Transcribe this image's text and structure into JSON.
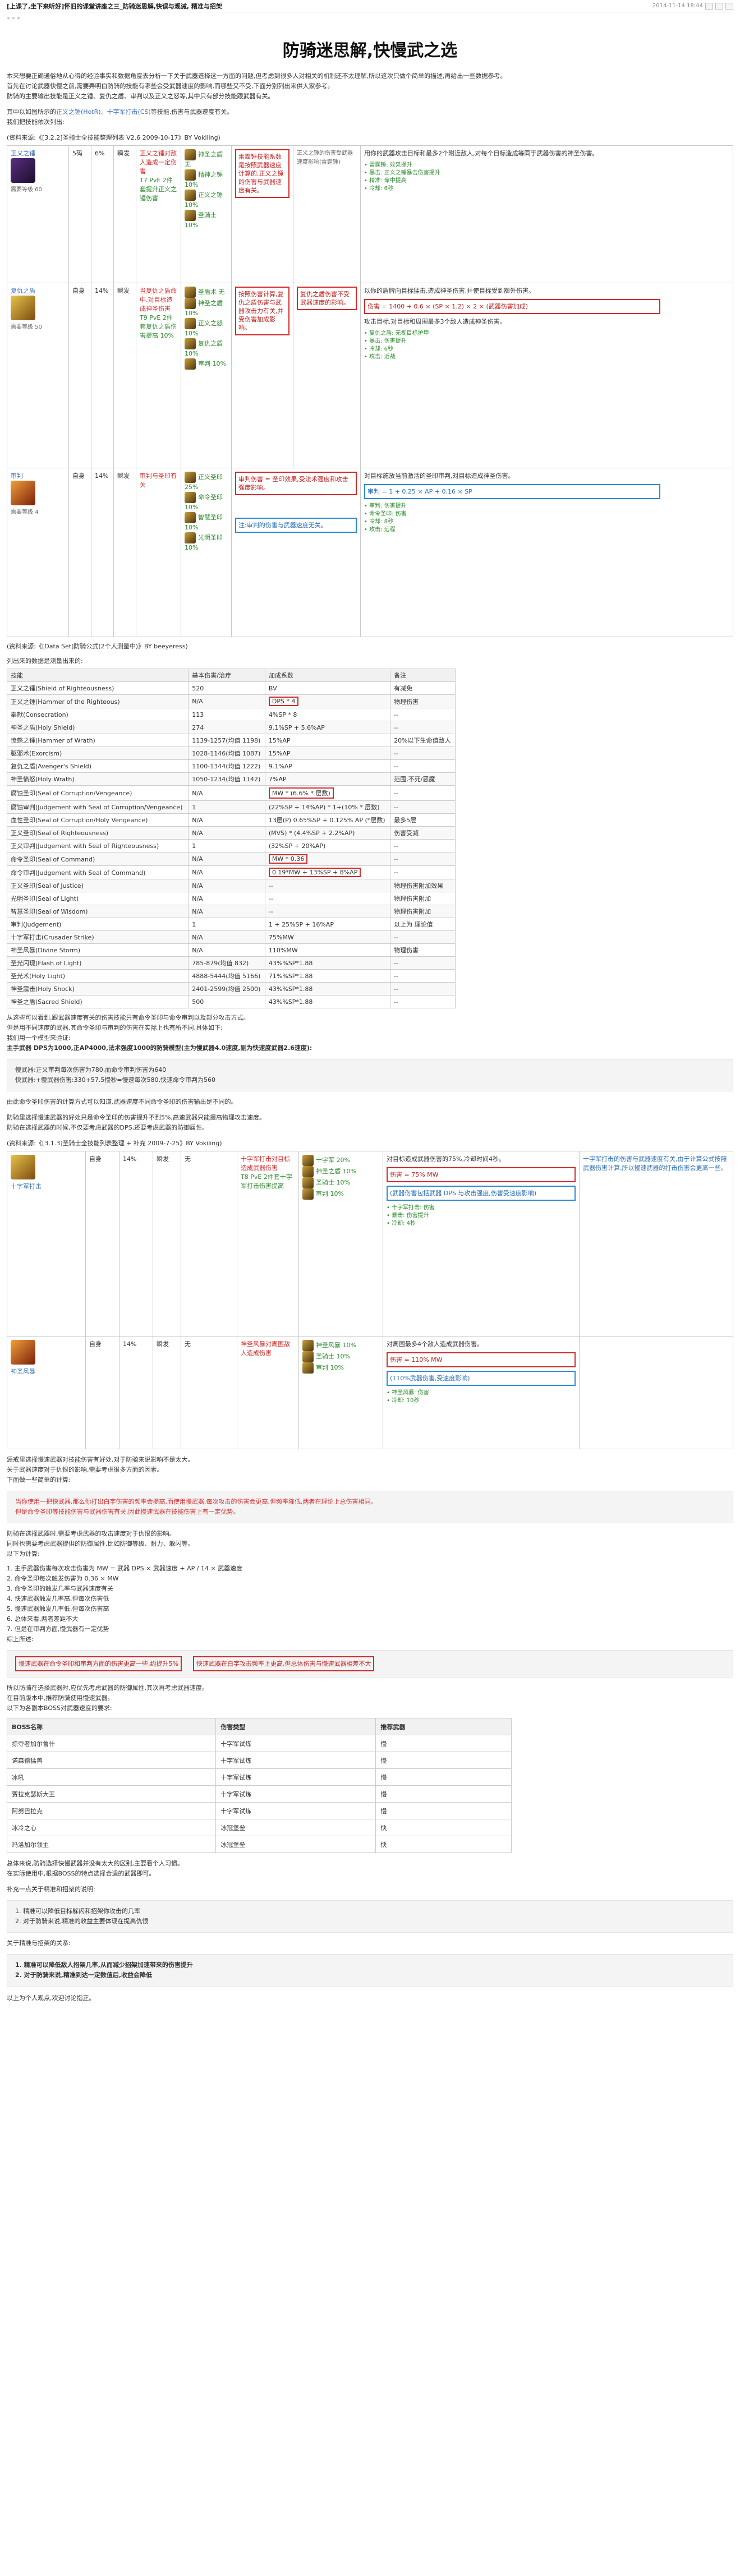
{
  "post": {
    "title": "[上课了,坐下来听好]怀旧的课堂讲座之三_防骑迷思解,快误与观诫, 精准与招架",
    "date": "2014-11-14 18:44",
    "stars": "* * *"
  },
  "article": {
    "heading": "防骑迷思解,快慢武之选"
  },
  "intro": {
    "l1": "本来想要正确通俗地从心得的经验事实和数据角度去分析一下关于武器选择这一方面的问题,但考虑到很多人对相关的机制还不太理解,所以这次只做个简单的描述,再给出一些数据参考。",
    "l2": "首先在讨论武器快慢之前,需要弄明白防骑的技能有哪些会受武器速度的影响,而哪些又不受,下面分别列出来供大家参考。",
    "l3": "防骑的主要输出技能是正义之锤、复仇之盾、审判以及正义之怒等,其中只有部分技能跟武器有关。",
    "l4a": "其中以如图所示的",
    "l4link": "正义之锤(HotR)、十字军打击(CS)",
    "l4b": "等技能,伤害与武器速度有关。",
    "l5": "我们把技能依次列出:"
  },
  "sources": {
    "s1": "(资料来源:《[3.2.2]圣骑士全技能整理列表 V2.6 2009-10-17》BY Vokiling)",
    "s2": "(资料来源:《[Data Set]防骑公式(2个人测量中)》BY beeyeress)",
    "s3": "列出来的数据是测量出来的:",
    "s4": "(资料来源:《[3.1.3]圣骑士全技能列表整理 + 补充 2009-7-25》BY Vokiling)"
  },
  "block1": {
    "row1": {
      "name": "正义之锤",
      "caption": "需要等级 60",
      "c1": "5码",
      "c2": "6%",
      "c3": "瞬发",
      "c4a": "正义之锤对敌人造成一定伤害",
      "c4b": "T7 PvE 2件套提升正义之锤伤害",
      "t1": "神圣之盾 无",
      "t2": "精神之锤 10%",
      "t3": "正义之锤 10%",
      "t4": "圣骑士 10%",
      "note": "雷霆锤技能系数是按照武器速度计算的,正义之锤的伤害与武器速度有关。",
      "note2": "正义之锤的伤害受武器速度影响(雷霆锤)",
      "desc": "用你的武器攻击目标和最多2个附近敌人,对每个目标造成等同于武器伤害的神圣伤害。",
      "b1": "• 雷霆锤: 效果提升",
      "b2": "• 暴击: 正义之锤暴击伤害提升",
      "b3": "• 精准: 命中提高",
      "b4": "• 冷却: 6秒"
    },
    "row2": {
      "name": "复仇之盾",
      "caption": "需要等级 50",
      "c1": "自身",
      "c2": "14%",
      "c3": "瞬发",
      "c4a": "当复仇之盾命中,对目标造成神圣伤害",
      "c4b": "T9 PvE 2件套复仇之盾伤害提高 10%",
      "t1": "圣盾术 无",
      "t2": "神圣之盾 10%",
      "t3": "正义之怒 10%",
      "t4": "复仇之盾 10%",
      "t5": "审判 10%",
      "note": "按照伤害计算,复仇之盾伤害与武器攻击力有关,并受伤害加成影响。",
      "note2": "复仇之盾伤害不受武器速度的影响。",
      "desc": "以你的盾牌向目标猛击,造成神圣伤害,并使目标受到额外伤害。",
      "formula": "伤害 = 1400 + 0.6 × (SP × 1.2) × 2 × (武器伤害加成)",
      "desc2": "攻击目标,对目标和周围最多3个敌人造成神圣伤害。",
      "b1": "• 复仇之盾: 无视目标护甲",
      "b2": "• 暴击: 伤害提升",
      "b3": "• 冷却: 6秒",
      "b4": "• 攻击: 近战"
    },
    "row3": {
      "name": "审判",
      "caption": "需要等级 4",
      "c1": "自身",
      "c2": "14%",
      "c3": "瞬发",
      "c4a": "审判与圣印有关",
      "t1": "正义圣印 25%",
      "t2": "命令圣印 10%",
      "t3": "智慧圣印 10%",
      "t4": "光明圣印 10%",
      "note": "审判伤害 = 圣印效果,受法术强度和攻击强度影响。",
      "note2": "注:审判的伤害与武器速度无关。",
      "desc": "对目标施放当前激活的圣印审判,对目标造成神圣伤害。",
      "formula": "审判 = 1 + 0.25 × AP + 0.16 × SP",
      "b1": "• 审判: 伤害提升",
      "b2": "• 命令圣印: 伤害",
      "b3": "• 冷却: 8秒",
      "b4": "• 攻击: 远程"
    }
  },
  "table1": {
    "headers": [
      "技能",
      "基本伤害/治疗",
      "加成系数",
      "备注"
    ],
    "rows": [
      [
        "正义之锤(Shield of Righteousness)",
        "520",
        "BV",
        "有减免"
      ],
      [
        "正义之锤(Hammer of the Righteous)",
        "N/A",
        "DPS * 4",
        "物理伤害"
      ],
      [
        "奉献(Consecration)",
        "113",
        "4%SP * 8",
        "--"
      ],
      [
        "神圣之盾(Holy Shield)",
        "274",
        "9.1%SP + 5.6%AP",
        "--"
      ],
      [
        "愤怒之锤(Hammer of Wrath)",
        "1139-1257(均值 1198)",
        "15%AP",
        "20%以下生命值敌人"
      ],
      [
        "驱邪术(Exorcism)",
        "1028-1146(均值 1087)",
        "15%AP",
        "--"
      ],
      [
        "复仇之盾(Avenger's Shield)",
        "1100-1344(均值 1222)",
        "9.1%AP",
        "--"
      ],
      [
        "神圣愤怒(Holy Wrath)",
        "1050-1234(均值 1142)",
        "7%AP",
        "范围,不死/恶魔"
      ],
      [
        "腐蚀圣印(Seal of Corruption/Vengeance)",
        "N/A",
        "MW * (6.6% * 层数)",
        "--"
      ],
      [
        "腐蚀审判(Judgement with Seal of Corruption/Vengeance)",
        "1",
        "(22%SP + 14%AP) * 1+(10% * 层数)",
        "--"
      ],
      [
        "血性圣印(Seal of Corruption/Holy Vengeance)",
        "N/A",
        "13层(P) 0.65%SP + 0.125% AP (*层数)",
        "最多5层"
      ],
      [
        "正义圣印(Seal of Righteousness)",
        "N/A",
        "(MVS) * (4.4%SP + 2.2%AP)",
        "伤害受减"
      ],
      [
        "正义审判(Judgement with Seal of Righteousness)",
        "1",
        "(32%SP + 20%AP)",
        "--"
      ],
      [
        "命令圣印(Seal of Command)",
        "N/A",
        "MW * 0.36",
        "--"
      ],
      [
        "命令审判(Judgement with Seal of Command)",
        "N/A",
        "0.19*MW + 13%SP + 8%AP",
        "--"
      ],
      [
        "正义圣印(Seal of Justice)",
        "N/A",
        "--",
        "物理伤害附加效果"
      ],
      [
        "光明圣印(Seal of Light)",
        "N/A",
        "--",
        "物理伤害附加"
      ],
      [
        "智慧圣印(Seal of Wisdom)",
        "N/A",
        "--",
        "物理伤害附加"
      ],
      [
        "审判(Judgement)",
        "1",
        "1 + 25%SP + 16%AP",
        "以上为 理论值"
      ],
      [
        "十字军打击(Crusader Strike)",
        "N/A",
        "75%MW",
        "--"
      ],
      [
        "神圣风暴(Divine Storm)",
        "N/A",
        "110%MW",
        "物理伤害"
      ],
      [
        "圣光闪现(Flash of Light)",
        "785-879(均值 832)",
        "43%%SP*1.88",
        "--"
      ],
      [
        "圣光术(Holy Light)",
        "4888-5444(均值 5166)",
        "71%%SP*1.88",
        "--"
      ],
      [
        "神圣震击(Holy Shock)",
        "2401-2599(均值 2500)",
        "43%%SP*1.88",
        "--"
      ],
      [
        "神圣之盾(Sacred Shield)",
        "500",
        "43%%SP*1.88",
        "--"
      ]
    ]
  },
  "after_table": {
    "l1": "从这些可以看到,跟武器速度有关的伤害技能只有命令圣印与命令审判以及部分攻击方式。",
    "l2": "但是用不同速度的武器,其命令圣印与审判的伤害在实际上也有所不同,具体如下:",
    "l3": "我们用一个模型来验证:",
    "l4": "主手武器 DPS为1000,正AP4000,法术强度1000的防骑模型(主为慢武器4.0速度,副为快速度武器2.6速度):"
  },
  "quote1": {
    "l1": "慢武器:正义审判每次伤害为780,而命令审判伤害为640",
    "l2": "快武器:+慢武器伤害:330+57.5慢秒=慢速每次580,快速命令审判为560"
  },
  "after_quote": {
    "l1": "由此命令圣印伤害的计算方式可以知道,武器速度不同命令圣印的伤害输出是不同的。",
    "l2": "防骑里选择慢速武器的好处只是命令圣印的伤害提升不到5%,高速武器只能提高物理攻击速度。",
    "l3": "防骑在选择武器的时候,不仅要考虑武器的DPS,还要考虑武器的防御属性。"
  },
  "block2": {
    "row1": {
      "name": "十字军打击",
      "c1": "自身",
      "c2": "14%",
      "c3": "瞬发",
      "c4": "无",
      "c5a": "十字军打击对目标造成武器伤害",
      "c5b": "T8 PvE 2件套十字军打击伤害提高",
      "t1": "十字军 20%",
      "t2": "神圣之盾 10%",
      "t3": "圣骑士 10%",
      "t4": "审判 10%",
      "desc": "对目标造成武器伤害的75%,冷却时间4秒。",
      "formula": "伤害 = 75% MW",
      "formula2": "(武器伤害包括武器 DPS 与攻击强度,伤害受速度影响)",
      "b1": "• 十字军打击: 伤害",
      "b2": "• 暴击: 伤害提升",
      "b3": "• 冷却: 4秒",
      "side": "十字军打击的伤害与武器速度有关,由于计算公式按照武器伤害计算,所以慢速武器的打击伤害会更高一些。"
    },
    "row2": {
      "name": "神圣风暴",
      "c1": "自身",
      "c2": "14%",
      "c3": "瞬发",
      "c4": "无",
      "c5a": "神圣风暴对周围敌人造成伤害",
      "t1": "神圣风暴 10%",
      "t2": "圣骑士 10%",
      "t3": "审判 10%",
      "desc": "对周围最多4个敌人造成武器伤害。",
      "formula": "伤害 = 110% MW",
      "formula2": "(110%武器伤害,受速度影响)",
      "b1": "• 神圣风暴: 伤害",
      "b2": "• 冷却: 10秒"
    }
  },
  "after_block2": {
    "l1": "惩戒里选择慢速武器对技能伤害有好处,对于防骑来说影响不是太大。",
    "l2": "关于武器速度对于仇恨的影响,需要考虑很多方面的因素。",
    "l3": "下面做一些简单的计算:"
  },
  "quote2": {
    "l1": "当你使用一把快武器,那么你打出白字伤害的频率会提高,而使用慢武器,每次攻击的伤害会更高,但频率降低,两者在理论上总伤害相同。",
    "l2": "但是命令圣印等技能伤害与武器伤害有关,因此慢速武器在技能伤害上有一定优势。"
  },
  "calc": {
    "l1": "防骑在选择武器时,需要考虑武器的攻击速度对于仇恨的影响。",
    "l2": "同时也需要考虑武器提供的防御属性,比如防御等级、耐力、躲闪等。",
    "l3": "以下为计算:",
    "l4": "1. 主手武器伤害每次攻击伤害为 MW = 武器 DPS × 武器速度 + AP / 14 × 武器速度",
    "l5": "2. 命令圣印每次触发伤害为 0.36 × MW",
    "l6": "3. 命令圣印的触发几率与武器速度有关",
    "l7": "4. 快速武器触发几率高,但每次伤害低",
    "l8": "5. 慢速武器触发几率低,但每次伤害高",
    "l9": "6. 总体来看,两者差距不大",
    "l10": "7. 但是在审判方面,慢武器有一定优势",
    "l11": "综上所述:"
  },
  "quote3": {
    "l1": "慢速武器在命令圣印和审判方面的伤害更高一些,约提升5%",
    "l2": "快速武器在白字攻击频率上更高,但总体伤害与慢速武器相差不大"
  },
  "after_quote3": {
    "l1": "所以防骑在选择武器时,应优先考虑武器的防御属性,其次再考虑武器速度。",
    "l2": "在目前版本中,推荐防骑使用慢速武器。",
    "l3": "以下为各副本BOSS对武器速度的要求:"
  },
  "table2": {
    "headers": [
      "BOSS名称",
      "伤害类型",
      "推荐武器"
    ],
    "rows": [
      [
        "掠夺者加尔鲁什",
        "十字军试炼",
        "慢"
      ],
      [
        "诺森德猛兽",
        "十字军试炼",
        "慢"
      ],
      [
        "冰吼",
        "十字军试炼",
        "慢"
      ],
      [
        "贾拉克瑟斯大王",
        "十字军试炼",
        "慢"
      ],
      [
        "阿努巴拉克",
        "十字军试炼",
        "慢"
      ],
      [
        "冰冷之心",
        "冰冠堡垒",
        "快"
      ],
      [
        "玛洛加尔领主",
        "冰冠堡垒",
        "快"
      ]
    ]
  },
  "ending": {
    "l1": "总体来说,防骑选择快慢武器并没有太大的区别,主要看个人习惯。",
    "l2": "在实际使用中,根据BOSS的特点选择合适的武器即可。",
    "l3": "补充一点关于精准和招架的说明:",
    "l4": "关于精准与招架的关系:",
    "l5": "以上为个人观点,欢迎讨论指正。"
  },
  "quote4": {
    "l1": "1. 精准可以降低目标躲闪和招架你攻击的几率",
    "l2": "2. 对于防骑来说,精准的收益主要体现在提高仇恨"
  },
  "quote5": {
    "l1": "1. 精准可以降低敌人招架几率,从而减少招架加速带来的伤害提升",
    "l2": "2. 对于防骑来说,精准到达一定数值后,收益会降低"
  }
}
